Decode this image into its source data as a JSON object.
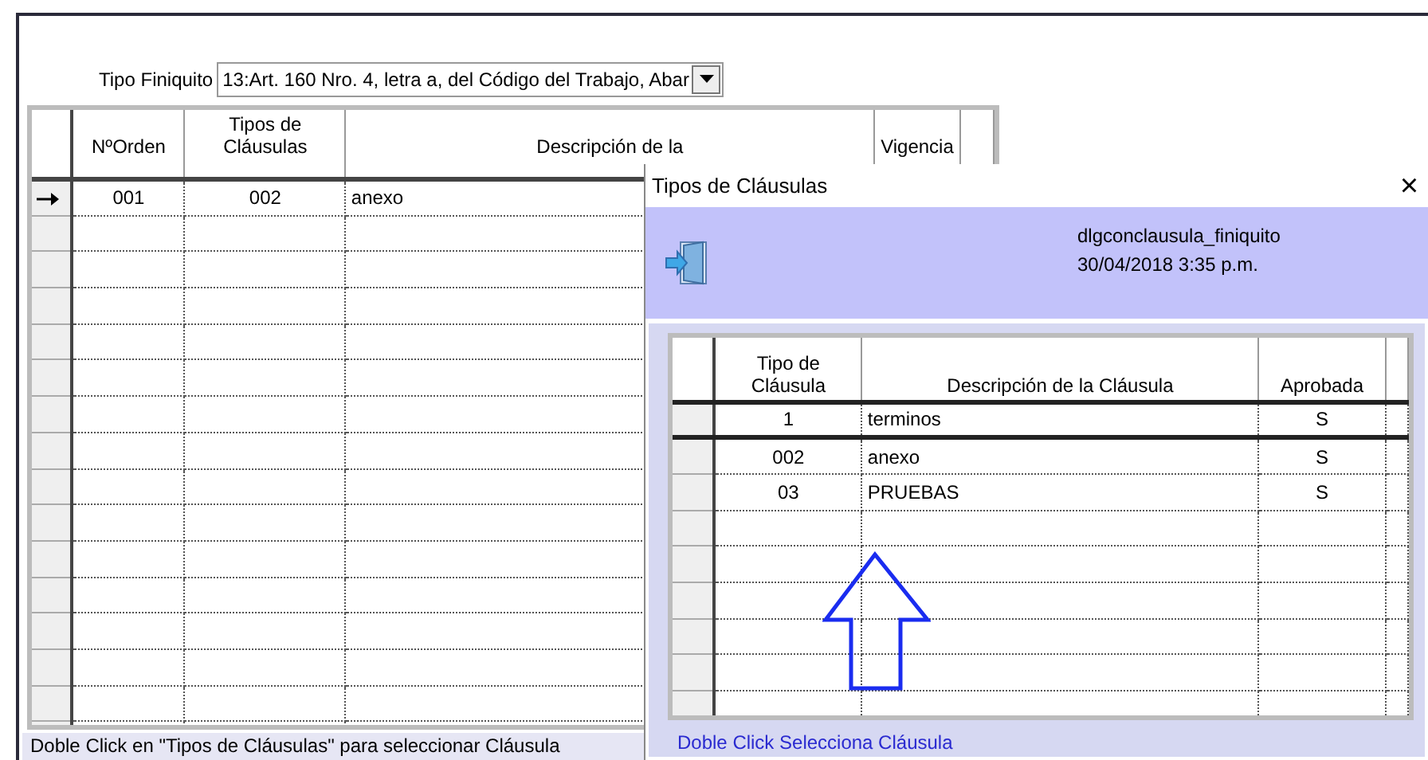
{
  "main": {
    "tipo_finiquito": {
      "label": "Tipo Finiquito",
      "value": "13:Art. 160 Nro. 4, letra a, del Código del Trabajo, Abar"
    },
    "grid": {
      "columns": [
        "NºOrden",
        "Tipos de Cláusulas",
        "Descripción de la",
        "Vigencia"
      ],
      "rows": [
        {
          "cells": [
            "001",
            "002",
            "anexo"
          ],
          "current": true
        }
      ]
    },
    "status": "Doble Click en \"Tipos de Cláusulas\" para seleccionar Cláusula"
  },
  "dialog": {
    "title": "Tipos de Cláusulas",
    "close": "×",
    "form_name": "dlgconclausula_finiquito",
    "date": "30/04/2018 3:35 p.m.",
    "grid": {
      "columns": [
        "Tipo de Cláusula",
        "Descripción de la Cláusula",
        "Aprobada"
      ],
      "rows": [
        {
          "cells": [
            "1",
            "terminos",
            "S"
          ],
          "selected": true
        },
        {
          "cells": [
            "002",
            "anexo",
            "S"
          ],
          "selected": false
        },
        {
          "cells": [
            "03",
            "PRUEBAS",
            "S"
          ],
          "selected": false
        }
      ]
    },
    "footer": "Doble Click Selecciona Cláusula"
  }
}
